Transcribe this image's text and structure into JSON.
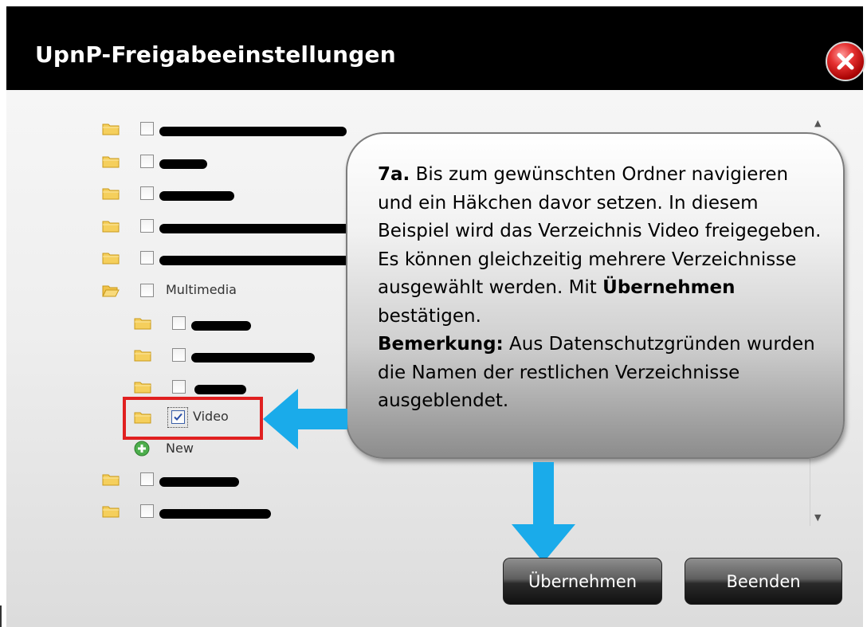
{
  "dialog": {
    "title": "UpnP-Freigabeeinstellungen"
  },
  "tree": {
    "multimedia_label": "Multimedia",
    "video_label": "Video",
    "new_label": "New",
    "video_checked": true
  },
  "callout": {
    "step": "7a.",
    "text1": " Bis zum gewünschten Ordner navigieren und ein Häkchen davor setzen. In diesem Beispiel wird das Verzeichnis Video freigegeben. Es können gleichzeitig mehrere Verzeichnisse ausgewählt werden. Mit ",
    "bold1": "Übernehmen",
    "text2": " bestätigen.",
    "bold2": "Bemerkung:",
    "text3": " Aus Datenschutzgründen wurden die Namen der restlichen Verzeichnisse ausgeblendet."
  },
  "buttons": {
    "apply": "Übernehmen",
    "close": "Beenden"
  },
  "colors": {
    "accent_arrow": "#1aabea",
    "highlight": "#e02020",
    "titlebar": "#000000"
  }
}
